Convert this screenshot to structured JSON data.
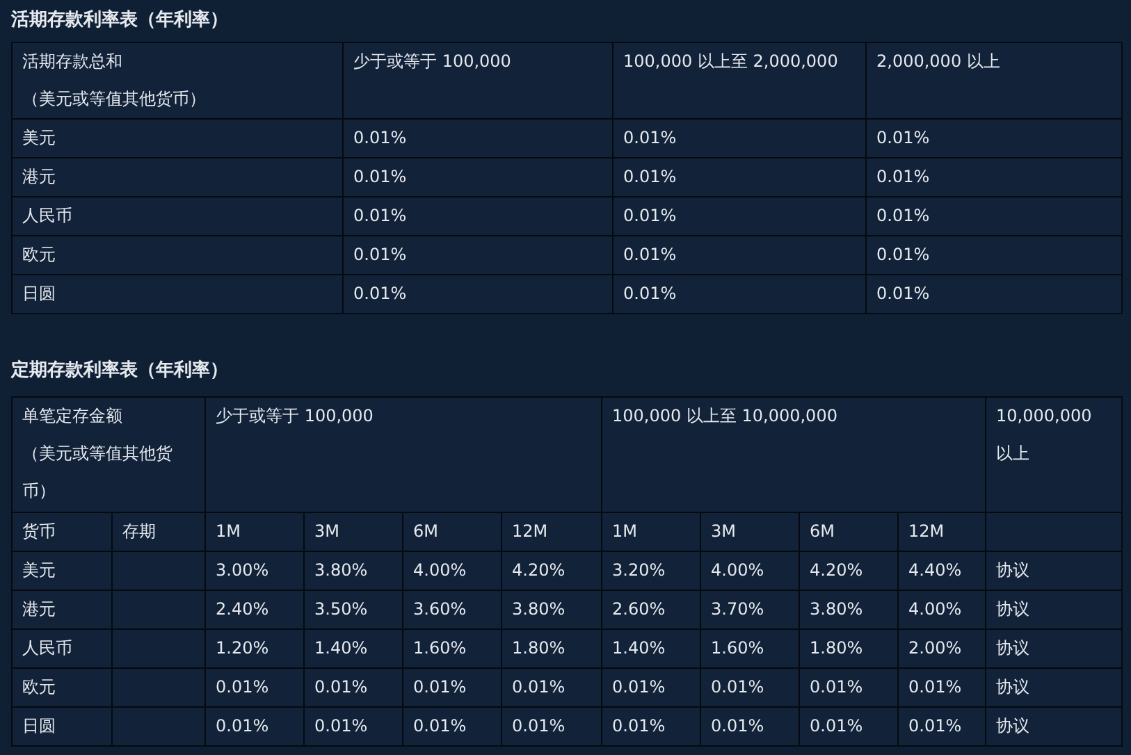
{
  "demand": {
    "title": "活期存款利率表（年利率）",
    "header": [
      [
        "活期存款总和",
        "（美元或等值其他货币）"
      ],
      "少于或等于 100,000",
      "100,000 以上至 2,000,000",
      "2,000,000 以上"
    ],
    "rows": [
      {
        "currency": "美元",
        "rates": [
          "0.01%",
          "0.01%",
          "0.01%"
        ]
      },
      {
        "currency": "港元",
        "rates": [
          "0.01%",
          "0.01%",
          "0.01%"
        ]
      },
      {
        "currency": "人民币",
        "rates": [
          "0.01%",
          "0.01%",
          "0.01%"
        ]
      },
      {
        "currency": "欧元",
        "rates": [
          "0.01%",
          "0.01%",
          "0.01%"
        ]
      },
      {
        "currency": "日圆",
        "rates": [
          "0.01%",
          "0.01%",
          "0.01%"
        ]
      }
    ]
  },
  "time": {
    "title": "定期存款利率表（年利率）",
    "header": {
      "amount": [
        "单笔定存金额",
        "（美元或等值其他货币）"
      ],
      "tiers": [
        "少于或等于 100,000",
        "100,000 以上至 10,000,000",
        "10,000,000 以上"
      ]
    },
    "subheader": {
      "currency": "货币",
      "term": "存期",
      "terms": [
        "1M",
        "3M",
        "6M",
        "12M",
        "1M",
        "3M",
        "6M",
        "12M"
      ]
    },
    "rows": [
      {
        "currency": "美元",
        "rates": [
          "3.00%",
          "3.80%",
          "4.00%",
          "4.20%",
          "3.20%",
          "4.00%",
          "4.20%",
          "4.40%"
        ],
        "top": "协议"
      },
      {
        "currency": "港元",
        "rates": [
          "2.40%",
          "3.50%",
          "3.60%",
          "3.80%",
          "2.60%",
          "3.70%",
          "3.80%",
          "4.00%"
        ],
        "top": "协议"
      },
      {
        "currency": "人民币",
        "rates": [
          "1.20%",
          "1.40%",
          "1.60%",
          "1.80%",
          "1.40%",
          "1.60%",
          "1.80%",
          "2.00%"
        ],
        "top": "协议"
      },
      {
        "currency": "欧元",
        "rates": [
          "0.01%",
          "0.01%",
          "0.01%",
          "0.01%",
          "0.01%",
          "0.01%",
          "0.01%",
          "0.01%"
        ],
        "top": "协议"
      },
      {
        "currency": "日圆",
        "rates": [
          "0.01%",
          "0.01%",
          "0.01%",
          "0.01%",
          "0.01%",
          "0.01%",
          "0.01%",
          "0.01%"
        ],
        "top": "协议"
      }
    ]
  }
}
